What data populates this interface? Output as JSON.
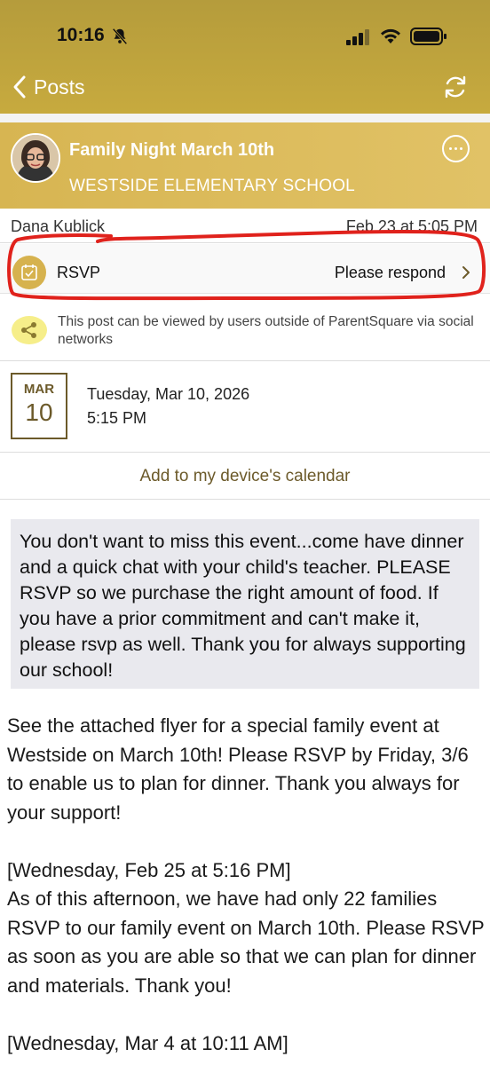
{
  "status_bar": {
    "time": "10:16"
  },
  "nav": {
    "back_label": "Posts"
  },
  "post": {
    "title": "Family Night March 10th",
    "school": "WESTSIDE ELEMENTARY SCHOOL",
    "author": "Dana Kublick",
    "date": "Feb 23 at 5:05 PM"
  },
  "rsvp": {
    "label": "RSVP",
    "status": "Please respond"
  },
  "share_notice": "This post can be viewed by users outside of ParentSquare via social networks",
  "event": {
    "month": "MAR",
    "day": "10",
    "date": "Tuesday, Mar 10, 2026",
    "time": "5:15 PM"
  },
  "add_calendar_label": "Add to my device's calendar",
  "note": "You don't want to miss this event...come have dinner and a quick chat with your child's teacher. PLEASE RSVP so we purchase the right amount of food. If you have a prior commitment and can't make it, please rsvp as well. Thank you for always supporting our school!",
  "body": {
    "p1": "See the attached flyer for a special family event at Westside on March 10th! Please RSVP by Friday, 3/6 to enable us to plan for dinner. Thank you always for your support!",
    "update1_stamp": "[Wednesday, Feb 25 at 5:16 PM]",
    "update1_text": "As of this afternoon, we have had only 22 families RSVP to our family event on March 10th. Please RSVP as soon as you are able so that we can plan for dinner and materials. Thank you!",
    "update2_stamp": "[Wednesday, Mar 4 at 10:11 AM]"
  },
  "colors": {
    "header_gold": "#c7aa3e",
    "post_header_gold": "#dcbc5c",
    "accent_brown": "#6c5a2a",
    "annotation_red": "#e0221c"
  }
}
